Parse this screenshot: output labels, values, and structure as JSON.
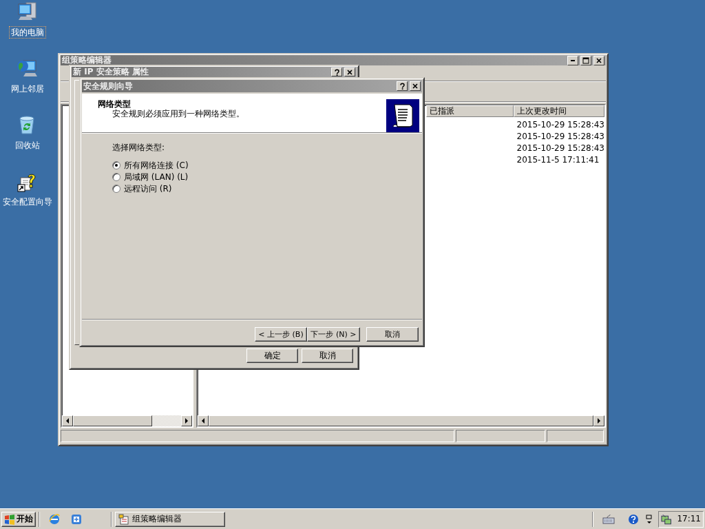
{
  "desktop_icons": [
    {
      "label": "我的电脑",
      "kind": "computer",
      "selected": true
    },
    {
      "label": "网上邻居",
      "kind": "network",
      "selected": false
    },
    {
      "label": "回收站",
      "kind": "recycle",
      "selected": false
    },
    {
      "label": "安全配置向导",
      "kind": "wizard",
      "selected": false
    }
  ],
  "main_window": {
    "title": "组策略编辑器",
    "columns": [
      "已指派",
      "上次更改时间"
    ],
    "rows": [
      {
        "changed": "2015-10-29 15:28:43"
      },
      {
        "changed": "2015-10-29 15:28:43"
      },
      {
        "changed": "2015-10-29 15:28:43"
      },
      {
        "changed": "2015-11-5 17:11:41"
      }
    ]
  },
  "properties_dialog": {
    "title": "新 IP 安全策略 属性",
    "buttons": [
      "确定",
      "取消"
    ]
  },
  "wizard": {
    "title": "安全规则向导",
    "heading": "网络类型",
    "subheading": "安全规则必须应用到一种网络类型。",
    "prompt": "选择网络类型:",
    "options": [
      {
        "label": "所有网络连接 (C)",
        "selected": true
      },
      {
        "label": "局域网 (LAN) (L)",
        "selected": false
      },
      {
        "label": "远程访问 (R)",
        "selected": false
      }
    ],
    "buttons": [
      "< 上一步 (B)",
      "下一步 (N) >",
      "取消"
    ]
  },
  "taskbar": {
    "start": "开始",
    "tasks": [
      {
        "label": "组策略编辑器"
      }
    ],
    "clock": "17:11"
  }
}
